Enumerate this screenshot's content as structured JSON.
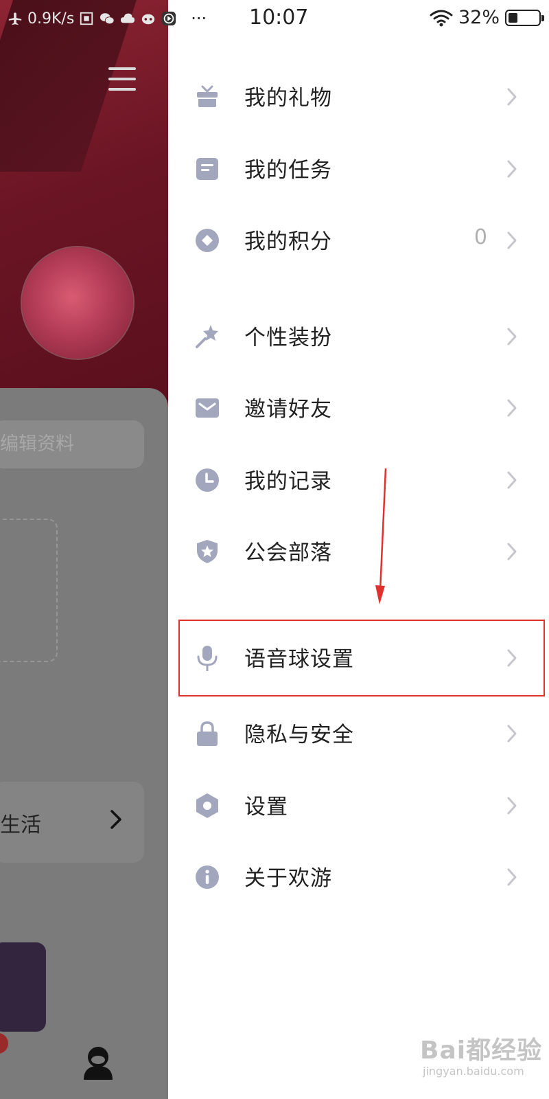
{
  "status_bar": {
    "network_speed": "0.9K/s",
    "time": "10:07",
    "battery_percent": "32%",
    "battery_level": 0.32,
    "more": "···"
  },
  "background": {
    "edit_profile_label": "编辑资料",
    "life_label": "生活"
  },
  "menu": {
    "items": [
      {
        "label": "我的礼物",
        "icon": "gift-icon"
      },
      {
        "label": "我的任务",
        "icon": "task-icon"
      },
      {
        "label": "我的积分",
        "icon": "points-icon",
        "value": "0"
      },
      {
        "label": "个性装扮",
        "icon": "magic-wand-icon"
      },
      {
        "label": "邀请好友",
        "icon": "mail-icon"
      },
      {
        "label": "我的记录",
        "icon": "clock-icon"
      },
      {
        "label": "公会部落",
        "icon": "shield-star-icon"
      },
      {
        "label": "语音球设置",
        "icon": "microphone-icon"
      },
      {
        "label": "隐私与安全",
        "icon": "lock-icon"
      },
      {
        "label": "设置",
        "icon": "gear-hexagon-icon"
      },
      {
        "label": "关于欢游",
        "icon": "info-icon"
      }
    ]
  },
  "colors": {
    "icon": "#a3a7bd",
    "chevron": "#c6c6cc",
    "highlight": "#e0322d",
    "text": "#222222"
  },
  "watermark": {
    "logo": "Bai都经验",
    "url": "jingyan.baidu.com"
  }
}
